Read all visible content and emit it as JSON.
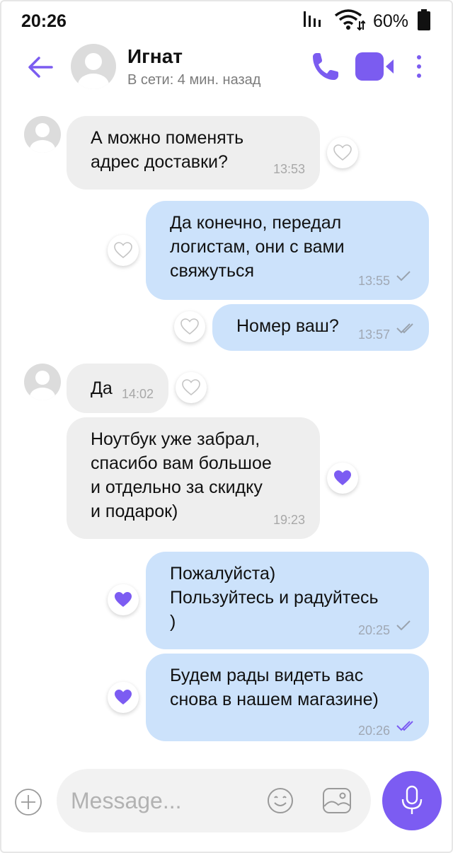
{
  "status_bar": {
    "time": "20:26",
    "battery": "60%"
  },
  "header": {
    "contact_name": "Игнат",
    "contact_status": "В сети: 4 мин. назад"
  },
  "messages": [
    {
      "text": "А можно поменять\nадрес доставки?",
      "time": "13:53",
      "direction": "in",
      "liked": false
    },
    {
      "text": "Да конечно, передал\nлогистам, они с вами\nсвяжуться",
      "time": "13:55",
      "direction": "out",
      "status": "sent",
      "liked": false
    },
    {
      "text": "Номер ваш?",
      "time": "13:57",
      "direction": "out",
      "status": "read",
      "liked": false
    },
    {
      "text": "Да",
      "time": "14:02",
      "direction": "in",
      "liked": false
    },
    {
      "text": "Ноутбук уже забрал,\nспасибо вам большое\nи отдельно за скидку\nи подарок)",
      "time": "19:23",
      "direction": "in",
      "liked": true
    },
    {
      "text": "Пожалуйста)\nПользуйтесь и радуйтесь\n)",
      "time": "20:25",
      "direction": "out",
      "status": "sent",
      "liked": true
    },
    {
      "text": "Будем рады видеть вас\nснова в нашем магазине)",
      "time": "20:26",
      "direction": "out",
      "status": "read",
      "liked": true
    }
  ],
  "composer": {
    "placeholder": "Message..."
  },
  "colors": {
    "accent": "#7c5cf2",
    "incoming_bubble": "#eeeeee",
    "outgoing_bubble": "#cce2fb"
  },
  "icons": [
    "back-arrow-icon",
    "phone-icon",
    "video-camera-icon",
    "more-vertical-icon",
    "heart-icon",
    "heart-filled-icon",
    "check-icon",
    "double-check-icon",
    "plus-circle-icon",
    "smiley-icon",
    "image-icon",
    "microphone-icon",
    "signal-icon",
    "wifi-icon",
    "battery-icon"
  ]
}
